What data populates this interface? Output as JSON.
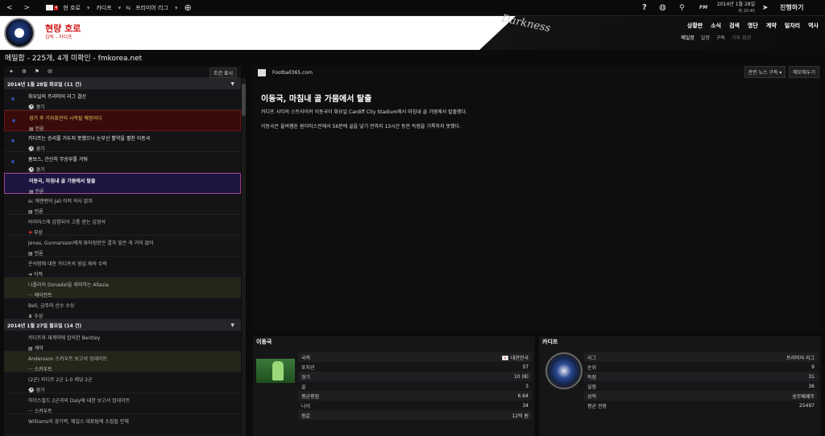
{
  "topbar": {
    "back": "<",
    "forward": ">",
    "mail_badge": "4",
    "home": "현 호로",
    "club": "카디프",
    "competition": "프리미어 리그",
    "date": "2014년 1월 28일",
    "time": "화 20:45",
    "continue": "진행하기",
    "help_icon": "?",
    "fm_label": "FM"
  },
  "header": {
    "manager_name": "현량 호로",
    "manager_sub": "감독 - 카디프",
    "skin": "Darkness",
    "nav_main": [
      "상황판",
      "소식",
      "검색",
      "명단",
      "계약",
      "일자리",
      "역사"
    ],
    "nav_sub": [
      "메일함",
      "일정",
      "구독",
      "기자 회견"
    ]
  },
  "page": {
    "title": "메일함 - 225개, 4개 미확인 - fmkorea.net"
  },
  "inbox": {
    "filter": "조건 표시",
    "groups": [
      {
        "date": "2014년 1월 28일 화요일 (11 건)",
        "items": [
          {
            "title": "화요일의 프리미어 리그 결산",
            "type": "경기",
            "style": "unread"
          },
          {
            "title": "경기 후 기자회견이 시작될 예정이다",
            "type": "언론",
            "style": "red"
          },
          {
            "title": "카디프는 승리를 거두지 못했으나 눈부신 활약을 펼친 이동국",
            "type": "경기",
            "style": "unread"
          },
          {
            "title": "홈보스, 간신히 무승부를 거둬",
            "type": "경기",
            "style": "unread"
          },
          {
            "title": "이동국, 마침내 골 가뭄에서 탈출",
            "type": "언론",
            "style": "sel"
          },
          {
            "title": "sc 헤렌벤의 Jali 이적 의사 밝혀",
            "type": "언론",
            "style": "read"
          },
          {
            "title": "바이러스에 감염되어 고통 받는 김정석",
            "type": "부상",
            "style": "read"
          },
          {
            "title": "Jenas, Gunnarsson에게 튜터링받은 결과 앞은 게 거의 없어",
            "type": "언론",
            "style": "read"
          },
          {
            "title": "온석명에 대한 카디프의 영입 제의 수락",
            "type": "이적",
            "style": "read"
          },
          {
            "title": "나폴리의 Donadel을 제외하는 Allasia",
            "type": "에이전트",
            "style": "yel"
          },
          {
            "title": "Bell, 금주의 선수 수상",
            "type": "수상",
            "style": "read"
          }
        ]
      },
      {
        "date": "2014년 1월 27일 월요일 (14 건)",
        "items": [
          {
            "title": "카디프와 재계약에 합의한 Bentley",
            "type": "계약",
            "style": "read"
          },
          {
            "title": "Andersson 스카우트 보고서 업데이트",
            "type": "스카우트",
            "style": "yel"
          },
          {
            "title": "(2군) 카디프 2군 1-0 레딩 2군",
            "type": "경기",
            "style": "read"
          },
          {
            "title": "허더스필드 2군과의 Daly에 대한 보고서 업데이트",
            "type": "스카우트",
            "style": "read"
          },
          {
            "title": "Williams의 경기력, 웨일스 대표팀에 소집될 만해",
            "type": "",
            "style": "read"
          }
        ]
      }
    ]
  },
  "article": {
    "source": "Football365.com",
    "related_btn": "관련 뉴스 구독 ▾",
    "memo_btn": "메모해두기",
    "headline": "이동국, 마침내 골 가뭄에서 탈출",
    "para1": "카디프 시티의 스트라이커 이동국이 화요일 Cardiff City Stadium에서 마침내 골 가뭄에서 탈출했다.",
    "para2": "이동국은 울버햄튼 원더러스전에서 56분에 골을 넣기 전까지 13시간 동안 득점을 기록하지 못했다."
  },
  "player_card": {
    "title": "이동국",
    "rows": [
      {
        "k": "국적",
        "v": "대한민국"
      },
      {
        "k": "포지션",
        "v": "ST"
      },
      {
        "k": "경기",
        "v": "10 (8)"
      },
      {
        "k": "골",
        "v": "3"
      },
      {
        "k": "평균평점",
        "v": "6.64"
      },
      {
        "k": "나이",
        "v": "34"
      },
      {
        "k": "몸값",
        "v": "12억 원"
      }
    ]
  },
  "club_card": {
    "title": "카디프",
    "rows": [
      {
        "k": "리그",
        "v": "프리미어 리그"
      },
      {
        "k": "순위",
        "v": "9"
      },
      {
        "k": "득점",
        "v": "31"
      },
      {
        "k": "실점",
        "v": "36"
      },
      {
        "k": "성적",
        "v": "승무패패무"
      },
      {
        "k": "평균 관중",
        "v": "25497"
      }
    ]
  }
}
